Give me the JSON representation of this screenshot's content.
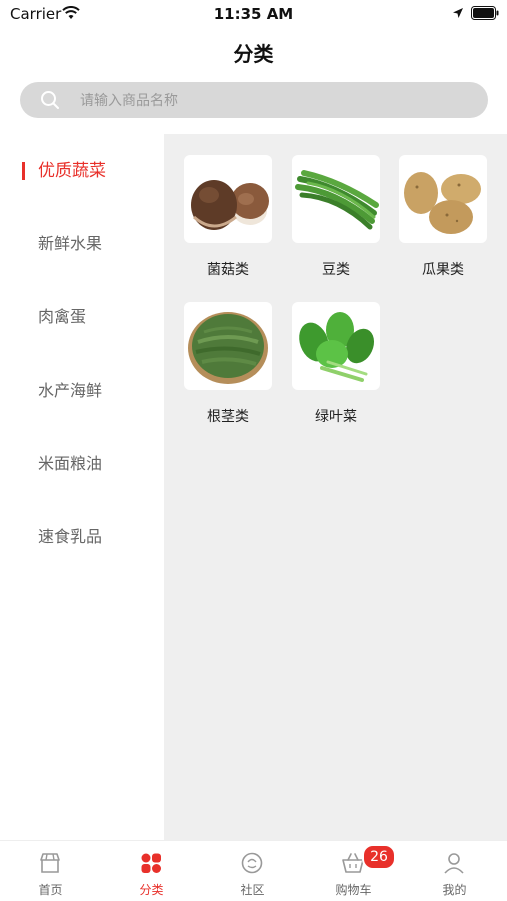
{
  "status_bar": {
    "carrier": "Carrier",
    "time": "11:35 AM"
  },
  "header": {
    "title": "分类"
  },
  "search": {
    "placeholder": "请输入商品名称"
  },
  "sidebar": {
    "items": [
      {
        "label": "优质蔬菜",
        "active": true
      },
      {
        "label": "新鲜水果"
      },
      {
        "label": "肉禽蛋"
      },
      {
        "label": "水产海鲜"
      },
      {
        "label": "米面粮油"
      },
      {
        "label": "速食乳品"
      }
    ]
  },
  "categories": [
    {
      "label": "菌菇类",
      "icon": "mushroom-icon"
    },
    {
      "label": "豆类",
      "icon": "bean-icon"
    },
    {
      "label": "瓜果类",
      "icon": "potato-icon"
    },
    {
      "label": "根茎类",
      "icon": "root-vegetable-icon"
    },
    {
      "label": "绿叶菜",
      "icon": "leafy-greens-icon"
    }
  ],
  "tabbar": {
    "items": [
      {
        "label": "首页",
        "icon": "shop-icon"
      },
      {
        "label": "分类",
        "icon": "category-grid-icon",
        "active": true
      },
      {
        "label": "社区",
        "icon": "community-icon"
      },
      {
        "label": "购物车",
        "icon": "cart-icon"
      },
      {
        "label": "我的",
        "icon": "user-icon"
      }
    ],
    "cart_badge": "26"
  },
  "colors": {
    "accent": "#e8302a",
    "content_bg": "#efefef",
    "search_bg": "#d8d8d8"
  }
}
